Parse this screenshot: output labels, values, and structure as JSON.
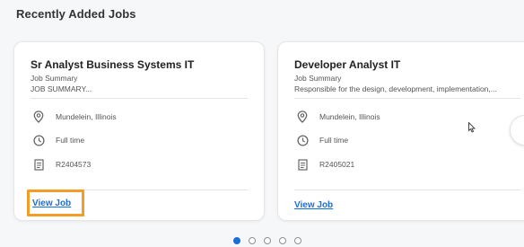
{
  "section": {
    "title": "Recently Added Jobs"
  },
  "jobs": [
    {
      "title": "Sr Analyst Business Systems IT",
      "summary_label": "Job Summary",
      "summary_text": "JOB SUMMARY...",
      "location": "Mundelein, Illinois",
      "time_type": "Full time",
      "requisition_id": "R2404573",
      "view_label": "View Job"
    },
    {
      "title": "Developer Analyst IT",
      "summary_label": "Job Summary",
      "summary_text": "Responsible for the design, development, implementation,...",
      "location": "Mundelein, Illinois",
      "time_type": "Full time",
      "requisition_id": "R2405021",
      "view_label": "View Job"
    }
  ],
  "carousel": {
    "page_count": 5,
    "active_page": 1
  },
  "colors": {
    "link": "#1a6ed8",
    "highlight": "#f39c28",
    "active_dot": "#1a6ed8"
  },
  "icons": {
    "location": "location-pin-icon",
    "time": "clock-icon",
    "requisition": "document-icon",
    "next": "chevron-right-icon"
  }
}
